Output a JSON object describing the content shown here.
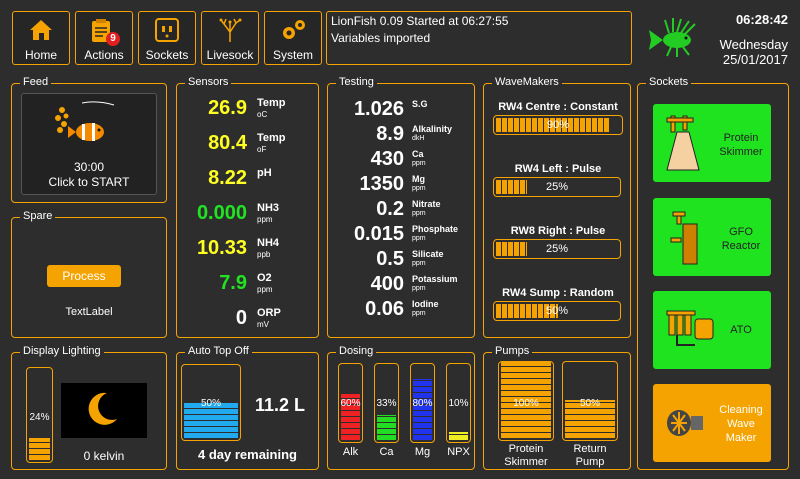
{
  "nav": {
    "home": "Home",
    "actions": "Actions",
    "actions_badge": "9",
    "sockets": "Sockets",
    "livesock": "Livesock",
    "system": "System"
  },
  "log": {
    "line1": "LionFish 0.09 Started at 06:27:55",
    "line2": "Variables imported"
  },
  "clock": {
    "time": "06:28:42",
    "day": "Wednesday",
    "date": "25/01/2017"
  },
  "feed": {
    "title": "Feed",
    "timer": "30:00",
    "action": "Click to START"
  },
  "spare": {
    "title": "Spare",
    "button": "Process",
    "label": "TextLabel"
  },
  "sensors": {
    "title": "Sensors",
    "items": [
      {
        "value": "26.9",
        "name": "Temp",
        "unit": "oC",
        "color": "#ffff22"
      },
      {
        "value": "80.4",
        "name": "Temp",
        "unit": "oF",
        "color": "#ffff22"
      },
      {
        "value": "8.22",
        "name": "pH",
        "unit": "",
        "color": "#ffff22"
      },
      {
        "value": "0.000",
        "name": "NH3",
        "unit": "ppm",
        "color": "#22e322"
      },
      {
        "value": "10.33",
        "name": "NH4",
        "unit": "ppb",
        "color": "#ffff22"
      },
      {
        "value": "7.9",
        "name": "O2",
        "unit": "ppm",
        "color": "#22e322"
      },
      {
        "value": "0",
        "name": "ORP",
        "unit": "mV",
        "color": "#ffffff"
      }
    ]
  },
  "testing": {
    "title": "Testing",
    "items": [
      {
        "value": "1.026",
        "name": "S.G",
        "unit": ""
      },
      {
        "value": "8.9",
        "name": "Alkalinity",
        "unit": "dkH"
      },
      {
        "value": "430",
        "name": "Ca",
        "unit": "ppm"
      },
      {
        "value": "1350",
        "name": "Mg",
        "unit": "ppm"
      },
      {
        "value": "0.2",
        "name": "Nitrate",
        "unit": "ppm"
      },
      {
        "value": "0.015",
        "name": "Phosphate",
        "unit": "ppm"
      },
      {
        "value": "0.5",
        "name": "Silicate",
        "unit": "ppm"
      },
      {
        "value": "400",
        "name": "Potassium",
        "unit": "ppm"
      },
      {
        "value": "0.06",
        "name": "Iodine",
        "unit": "ppm"
      }
    ]
  },
  "wavemakers": {
    "title": "WaveMakers",
    "items": [
      {
        "label": "RW4 Centre : Constant",
        "percent": 90,
        "text": "90%"
      },
      {
        "label": "RW4 Left : Pulse",
        "percent": 25,
        "text": "25%"
      },
      {
        "label": "RW8 Right : Pulse",
        "percent": 25,
        "text": "25%"
      },
      {
        "label": "RW4 Sump : Random",
        "percent": 50,
        "text": "50%"
      }
    ]
  },
  "sockets": {
    "title": "Sockets",
    "items": [
      {
        "label1": "Protein",
        "label2": "Skimmer",
        "label3": "",
        "color": "#1fe31f",
        "icon": "skimmer-icon"
      },
      {
        "label1": "GFO",
        "label2": "Reactor",
        "label3": "",
        "color": "#1fe31f",
        "icon": "reactor-icon"
      },
      {
        "label1": "ATO",
        "label2": "",
        "label3": "",
        "color": "#1fe31f",
        "icon": "ato-icon"
      },
      {
        "label1": "Cleaning",
        "label2": "Wave",
        "label3": "Maker",
        "color": "#f5a300",
        "icon": "wavemaker-icon"
      }
    ]
  },
  "lighting": {
    "title": "Display Lighting",
    "percent": 24,
    "text": "24%",
    "kelvin": "0 kelvin",
    "icon": "moon-icon"
  },
  "ato": {
    "title": "Auto Top Off",
    "percent": 50,
    "text": "50%",
    "level": "11.2 L",
    "remaining": "4 day remaining"
  },
  "dosing": {
    "title": "Dosing",
    "items": [
      {
        "label": "Alk",
        "percent": 60,
        "text": "60%",
        "color": "#ee2222"
      },
      {
        "label": "Ca",
        "percent": 33,
        "text": "33%",
        "color": "#22dd22"
      },
      {
        "label": "Mg",
        "percent": 80,
        "text": "80%",
        "color": "#2233ee"
      },
      {
        "label": "NPX",
        "percent": 10,
        "text": "10%",
        "color": "#eeee22"
      }
    ]
  },
  "pumps": {
    "title": "Pumps",
    "items": [
      {
        "label1": "Protein",
        "label2": "Skimmer",
        "percent": 100,
        "text": "100%"
      },
      {
        "label1": "Return",
        "label2": "Pump",
        "percent": 50,
        "text": "50%"
      }
    ]
  }
}
